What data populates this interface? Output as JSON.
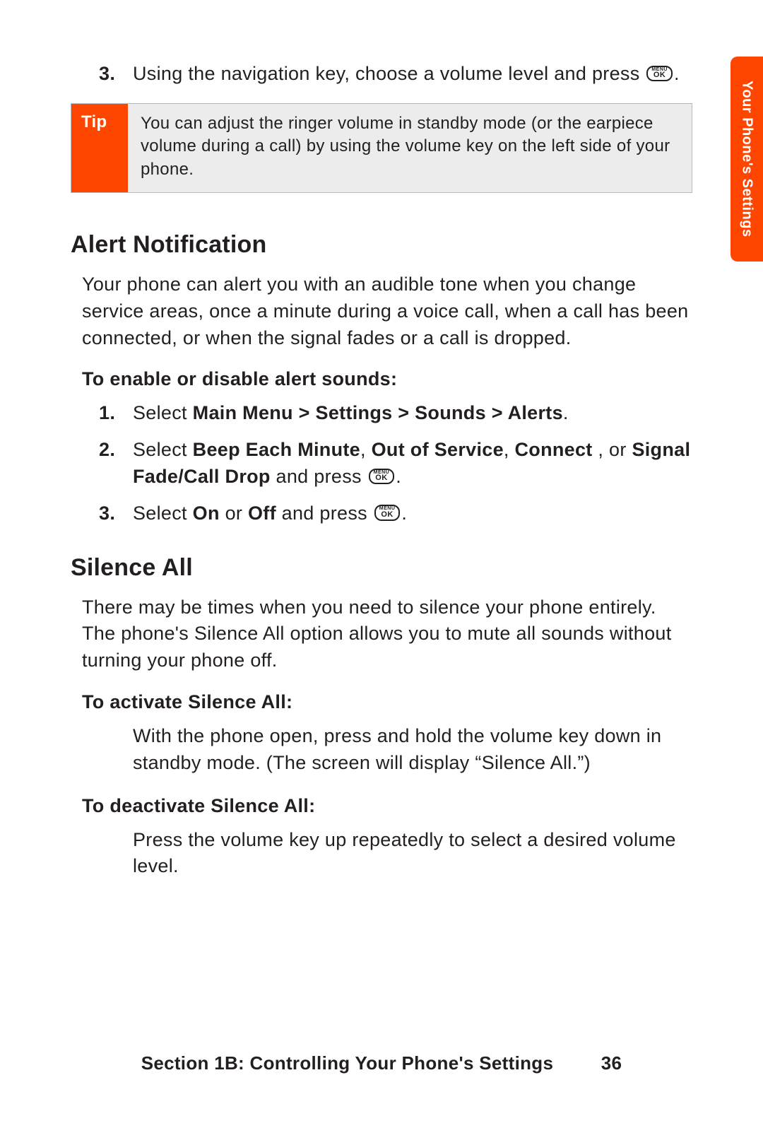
{
  "side_tab": "Your Phone's Settings",
  "key_icon": {
    "line1": "MENU",
    "line2": "OK"
  },
  "top_step": {
    "num": "3.",
    "text_before": "Using the navigation key, choose a volume level and press ",
    "text_after": "."
  },
  "tip": {
    "label": "Tip",
    "text": "You can adjust the ringer volume in standby mode (or the earpiece volume during a call) by using the volume key on the left side of your phone."
  },
  "alert": {
    "heading": "Alert Notification",
    "intro": "Your phone can alert you with an audible tone when you change service areas, once a minute during a voice call, when a call has been connected, or when the signal fades or a call is dropped.",
    "sub": "To enable or disable alert sounds:",
    "s1": {
      "num": "1.",
      "pre": "Select ",
      "bold": "Main Menu > Settings > Sounds > Alerts",
      "post": "."
    },
    "s2": {
      "num": "2.",
      "pre": "Select ",
      "b1": "Beep Each Minute",
      "c1": ", ",
      "b2": "Out of Service",
      "c2": ", ",
      "b3": "Connect",
      "c3": " , or ",
      "b4": "Signal Fade/Call Drop",
      "mid": " and press ",
      "post": "."
    },
    "s3": {
      "num": "3.",
      "pre": "Select ",
      "b1": "On",
      "mid1": " or ",
      "b2": "Off",
      "mid2": " and press ",
      "post": "."
    }
  },
  "silence": {
    "heading": "Silence All",
    "intro": "There may be times when you need to silence your phone entirely. The phone's Silence All option allows you to mute all sounds without turning your phone off.",
    "sub1": "To activate Silence All:",
    "body1": "With the phone open, press and hold the volume key down in standby mode. (The screen will display “Silence All.”)",
    "sub2": "To deactivate Silence All:",
    "body2": "Press the volume key up repeatedly to select a desired volume level."
  },
  "footer": {
    "section": "Section 1B: Controlling Your Phone's Settings",
    "page": "36"
  }
}
